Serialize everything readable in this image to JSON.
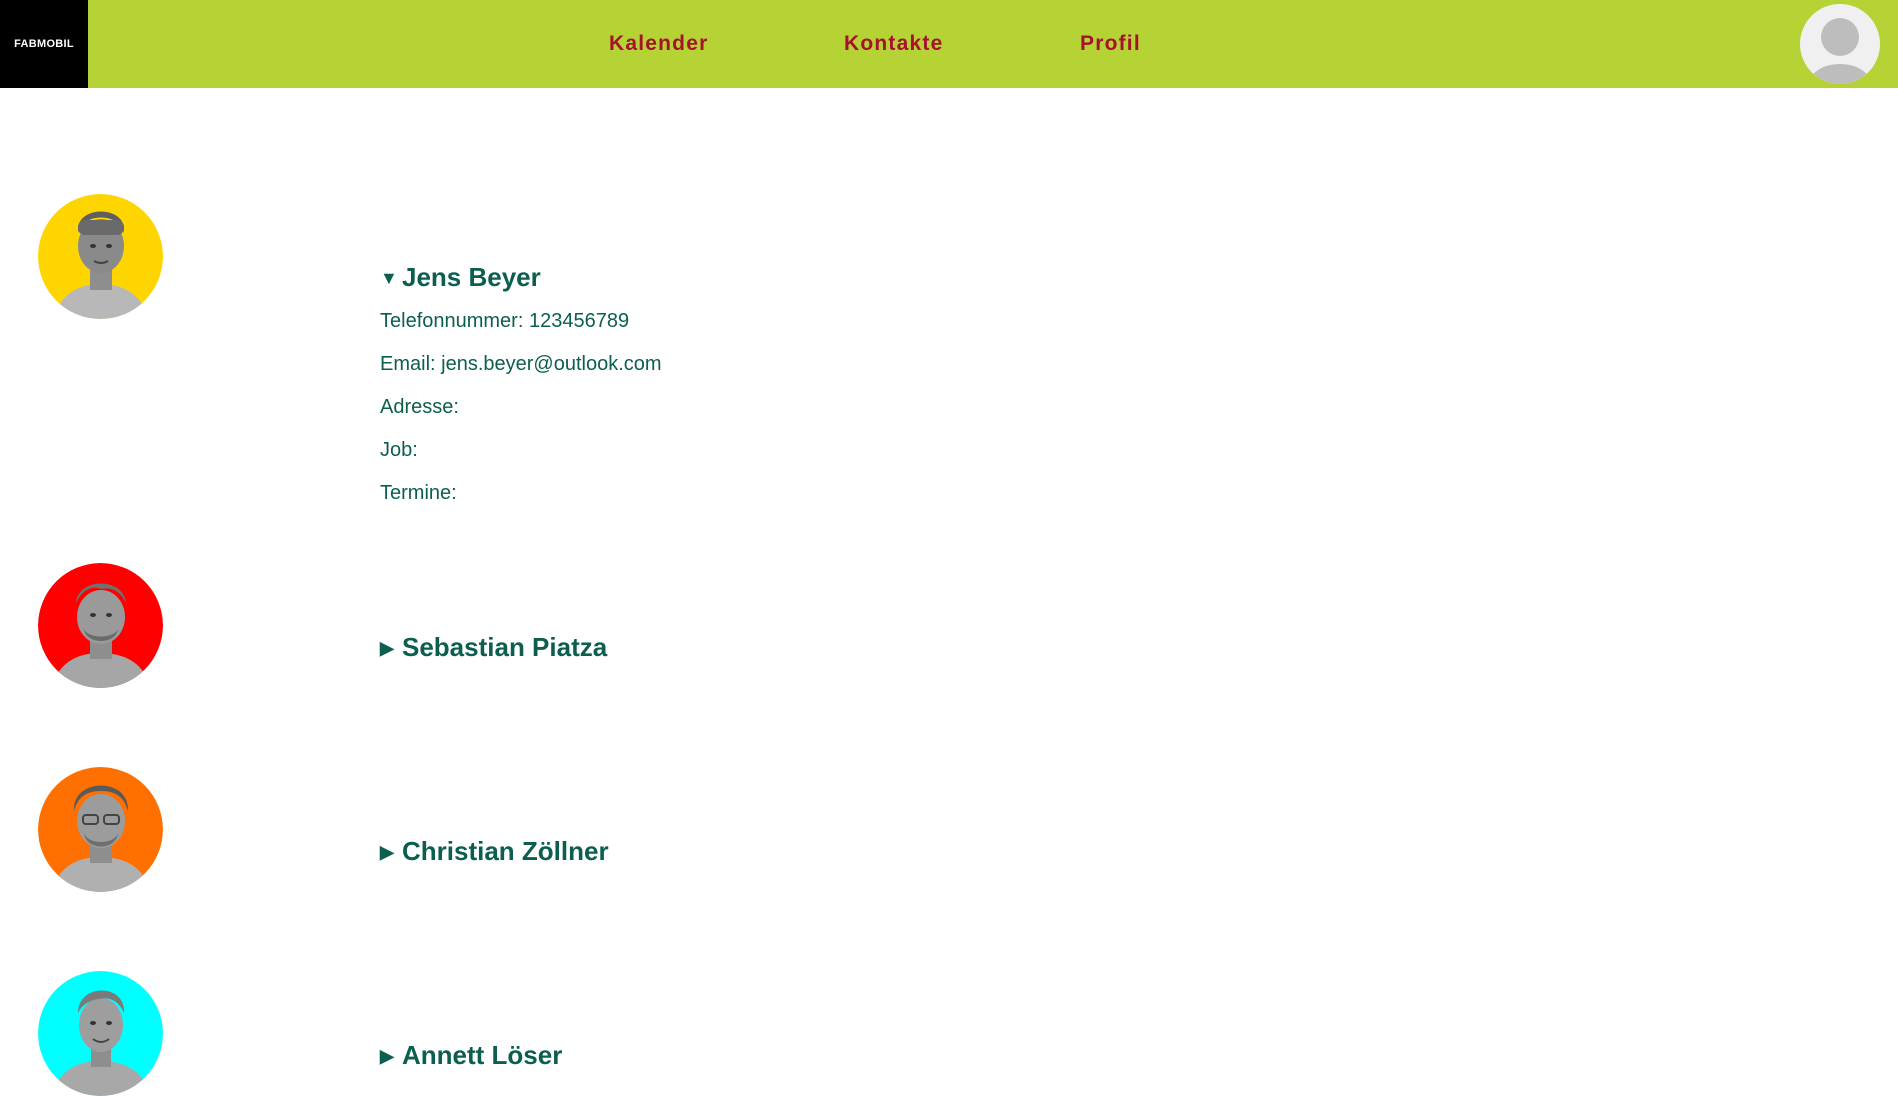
{
  "app": {
    "logo": "FABMOBIL",
    "nav": {
      "kalender": "Kalender",
      "kontakte": "Kontakte",
      "profil": "Profil"
    },
    "colors": {
      "topbar": "#b5d334",
      "nav_text": "#a5122a",
      "contact_text": "#0c5f4f"
    },
    "account_icon": "user-avatar-icon"
  },
  "contacts": [
    {
      "name": "Jens Beyer",
      "expanded": true,
      "caret": "▼",
      "avatar_color": "#ffd500",
      "details": {
        "phone": "Telefonnummer: 123456789",
        "email": "Email: jens.beyer@outlook.com",
        "address": "Adresse:",
        "job": "Job:",
        "appointments": "Termine:"
      }
    },
    {
      "name": "Sebastian Piatza",
      "expanded": false,
      "caret": "▶",
      "avatar_color": "#ff0000"
    },
    {
      "name": "Christian Zöllner",
      "expanded": false,
      "caret": "▶",
      "avatar_color": "#ff7000"
    },
    {
      "name": "Annett Löser",
      "expanded": false,
      "caret": "▶",
      "avatar_color": "#00ffff"
    }
  ]
}
